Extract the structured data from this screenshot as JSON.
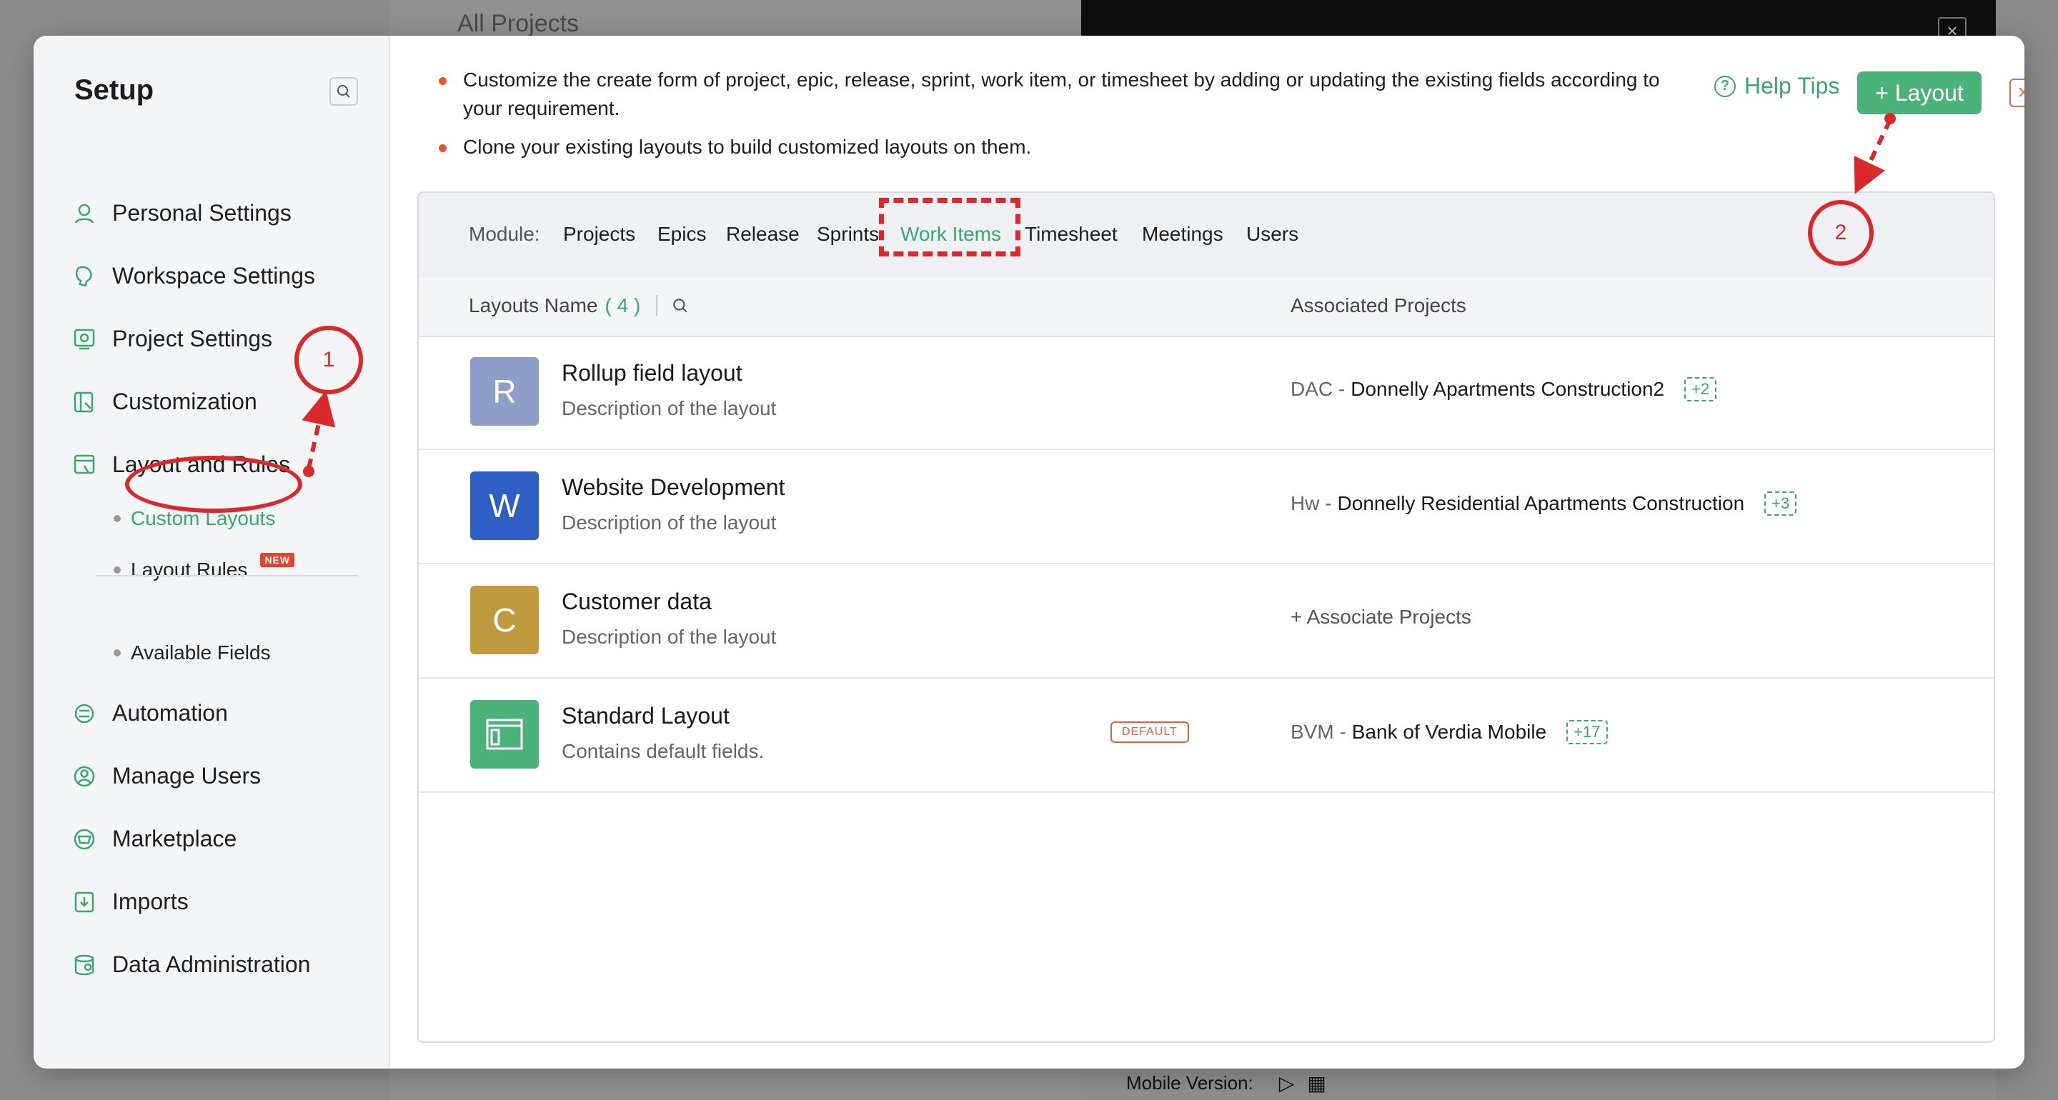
{
  "background": {
    "center_title": "All Projects",
    "mobile_version_label": "Mobile Version:"
  },
  "sidebar": {
    "title": "Setup",
    "items": [
      {
        "label": "Personal Settings",
        "icon": "personal-settings-icon"
      },
      {
        "label": "Workspace Settings",
        "icon": "workspace-settings-icon"
      },
      {
        "label": "Project Settings",
        "icon": "project-settings-icon"
      },
      {
        "label": "Customization",
        "icon": "customization-icon"
      },
      {
        "label": "Layout and Rules",
        "icon": "layout-rules-icon"
      }
    ],
    "sub_items": [
      {
        "label": "Custom Layouts"
      },
      {
        "label": "Layout Rules",
        "badge": "NEW"
      },
      {
        "label": "Available Fields"
      }
    ],
    "items_bottom": [
      {
        "label": "Automation",
        "icon": "automation-icon"
      },
      {
        "label": "Manage Users",
        "icon": "manage-users-icon"
      },
      {
        "label": "Marketplace",
        "icon": "marketplace-icon"
      },
      {
        "label": "Imports",
        "icon": "imports-icon"
      },
      {
        "label": "Data Administration",
        "icon": "data-administration-icon"
      }
    ]
  },
  "main": {
    "bullets": [
      "Customize the create form of project, epic, release, sprint, work item, or timesheet by adding or updating the existing fields according to your requirement.",
      "Clone your existing layouts to build customized layouts on them."
    ],
    "help_tips": "Help Tips",
    "add_layout": "+ Layout",
    "module_label": "Module:",
    "modules": [
      "Projects",
      "Epics",
      "Release",
      "Sprints",
      "Work Items",
      "Timesheet",
      "Meetings",
      "Users"
    ],
    "active_module": "Work Items",
    "table": {
      "col_name": "Layouts Name",
      "count": "( 4 )",
      "col_assoc": "Associated Projects"
    },
    "layouts": [
      {
        "initial": "R",
        "color": "#8e9ec9",
        "title": "Rollup field layout",
        "desc": "Description of the layout",
        "code": "DAC -",
        "project": "Donnelly Apartments Construction2",
        "more": "+2"
      },
      {
        "initial": "W",
        "color": "#2f5ec4",
        "title": "Website Development",
        "desc": "Description of the layout",
        "code": "Hw -",
        "project": "Donnelly Residential Apartments Construction",
        "more": "+3"
      },
      {
        "initial": "C",
        "color": "#c09a3e",
        "title": "Customer data",
        "desc": "Description of the layout",
        "assoc_link": "+ Associate Projects"
      },
      {
        "icon": "layout-panel-icon",
        "color": "#4bb27a",
        "title": "Standard Layout",
        "desc": "Contains default fields.",
        "badge": "DEFAULT",
        "code": "BVM -",
        "project": "Bank of Verdia Mobile",
        "more": "+17"
      }
    ]
  },
  "annotations": {
    "step1": "1",
    "step2": "2",
    "color": "#d9292b"
  }
}
